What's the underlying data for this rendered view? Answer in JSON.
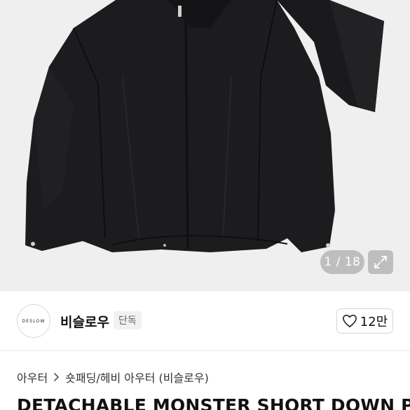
{
  "gallery": {
    "counter": "1 / 18",
    "icons": {
      "expand": "expand-arrows-icon"
    }
  },
  "brand": {
    "logo_text": "DESLOW",
    "name": "비슬로우",
    "badge": "단독",
    "likes": "12만",
    "icons": {
      "like": "heart-outline-icon"
    }
  },
  "breadcrumb": {
    "items": [
      "아우터",
      "숏패딩/헤비 아우터 (비슬로우)"
    ],
    "icons": {
      "separator": "chevron-right-icon"
    }
  },
  "product": {
    "title": "DETACHABLE MONSTER SHORT DOWN PA"
  },
  "colors": {
    "gallery_bg": "#efefef",
    "jacket": "#1c1c1e",
    "overlay": "#969696"
  }
}
